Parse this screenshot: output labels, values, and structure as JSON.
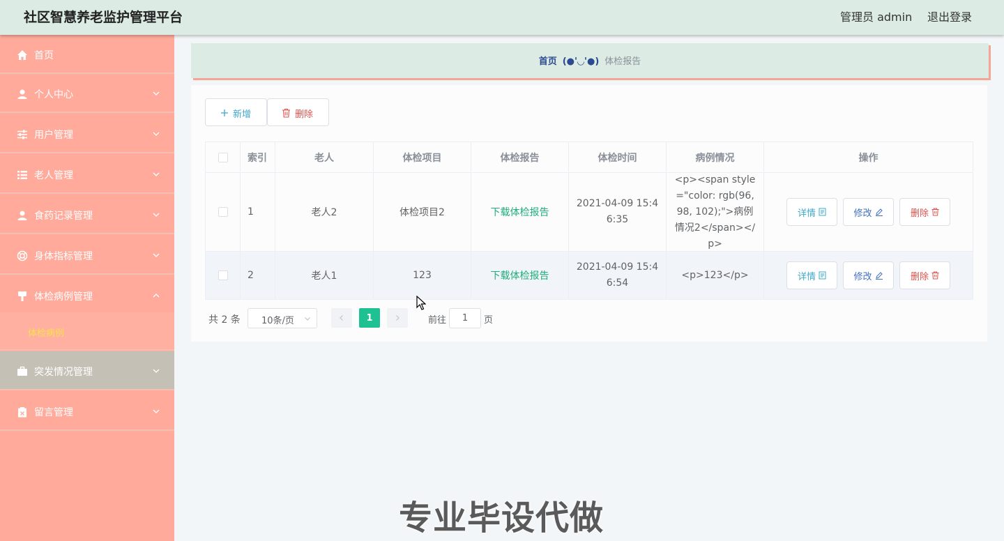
{
  "header": {
    "title": "社区智慧养老监护管理平台",
    "user": "管理员 admin",
    "logout": "退出登录"
  },
  "sidebar": {
    "items": [
      {
        "label": "首页",
        "icon": "home-icon"
      },
      {
        "label": "个人中心",
        "icon": "user-icon"
      },
      {
        "label": "用户管理",
        "icon": "sliders-icon"
      },
      {
        "label": "老人管理",
        "icon": "list-icon"
      },
      {
        "label": "食药记录管理",
        "icon": "user-icon"
      },
      {
        "label": "身体指标管理",
        "icon": "lifebuoy-icon"
      },
      {
        "label": "体检病例管理",
        "icon": "brush-icon"
      },
      {
        "label": "突发情况管理",
        "icon": "briefcase-icon"
      },
      {
        "label": "留言管理",
        "icon": "clipboard-icon"
      }
    ],
    "submenu": {
      "label": "体检病例"
    }
  },
  "breadcrumb": {
    "home": "首页",
    "separator": "(●'◡'●)",
    "current": "体检报告"
  },
  "toolbar": {
    "add_label": "新增",
    "delete_label": "删除"
  },
  "table": {
    "headers": [
      "索引",
      "老人",
      "体检项目",
      "体检报告",
      "体检时间",
      "病例情况",
      "操作"
    ],
    "rows": [
      {
        "index": "1",
        "elder": "老人2",
        "item": "体检项目2",
        "report": "下载体检报告",
        "time": "2021-04-09 15:46:35",
        "case": "<p><span style=\"color: rgb(96, 98, 102);\">病例情况2</span></p>"
      },
      {
        "index": "2",
        "elder": "老人1",
        "item": "123",
        "report": "下载体检报告",
        "time": "2021-04-09 15:46:54",
        "case": "<p>123</p>"
      }
    ],
    "actions": {
      "detail": "详情",
      "edit": "修改",
      "delete": "删除"
    }
  },
  "pagination": {
    "total": "共 2 条",
    "page_size": "10条/页",
    "current_page": "1",
    "goto_label": "前往",
    "goto_value": "1",
    "goto_suffix": "页"
  },
  "watermark": "专业毕设代做",
  "colors": {
    "header_bg": "#dcece4",
    "sidebar_bg": "#ffaa9b",
    "accent_green": "#1dc192",
    "submenu_text": "#f8e14a"
  }
}
